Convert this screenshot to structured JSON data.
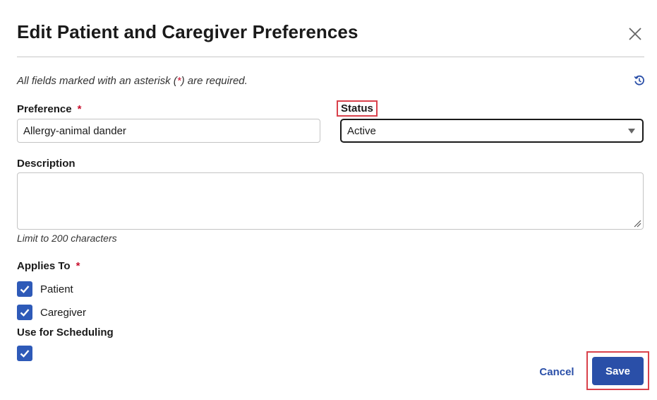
{
  "dialog": {
    "title": "Edit Patient and Caregiver Preferences",
    "required_note_prefix": "All fields marked with an asterisk (",
    "required_note_asterisk": "*",
    "required_note_suffix": ") are required."
  },
  "icons": {
    "close": "close-icon",
    "history": "history-icon",
    "caret": "chevron-down-icon",
    "check": "check-icon"
  },
  "form": {
    "preference": {
      "label": "Preference",
      "required_mark": "*",
      "value": "Allergy-animal dander"
    },
    "status": {
      "label": "Status",
      "selected": "Active"
    },
    "description": {
      "label": "Description",
      "value": "",
      "limit_note": "Limit to 200 characters"
    },
    "applies_to": {
      "label": "Applies To",
      "required_mark": "*",
      "options": [
        {
          "label": "Patient",
          "checked": true
        },
        {
          "label": "Caregiver",
          "checked": true
        }
      ]
    },
    "use_for_scheduling": {
      "label": "Use for Scheduling",
      "checked": true
    }
  },
  "actions": {
    "cancel_label": "Cancel",
    "save_label": "Save"
  },
  "colors": {
    "accent": "#2a4fa8",
    "checkbox": "#2e5ab8",
    "required": "#c8102e",
    "highlight": "#d9414b"
  }
}
